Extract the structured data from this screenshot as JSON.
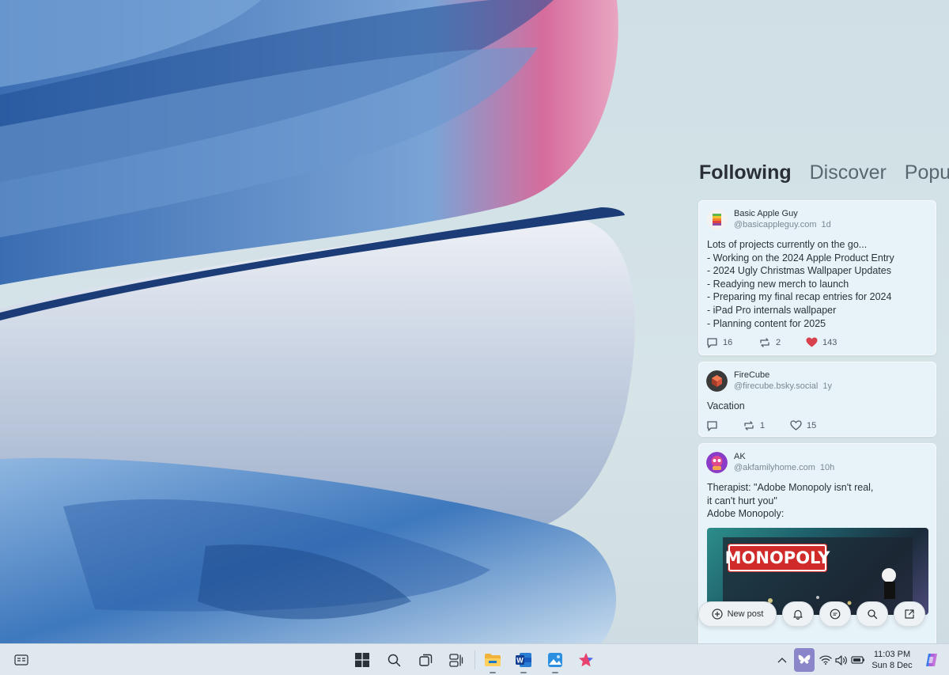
{
  "feed": {
    "tabs": [
      {
        "label": "Following"
      },
      {
        "label": "Discover"
      },
      {
        "label": "Popula"
      }
    ],
    "posts": [
      {
        "name": "Basic Apple Guy",
        "handle": "@basicappleguy.com",
        "time": "1d",
        "lines": [
          "Lots of projects currently on the go...",
          "- Working on the 2024 Apple Product Entry",
          "- 2024 Ugly Christmas Wallpaper Updates",
          "- Readying  new merch to launch",
          "- Preparing my final recap entries for 2024",
          "- iPad Pro internals wallpaper",
          "- Planning content for 2025"
        ],
        "replies": "16",
        "reposts": "2",
        "likes": "143"
      },
      {
        "name": "FireCube",
        "handle": "@firecube.bsky.social",
        "time": "1y",
        "lines": [
          "Vacation"
        ],
        "replies": "",
        "reposts": "1",
        "likes": "15"
      },
      {
        "name": "AK",
        "handle": "@akfamilyhome.com",
        "time": "10h",
        "lines": [
          "Therapist: \"Adobe Monopoly isn't real,",
          "it can't hurt you\"",
          "Adobe Monopoly:"
        ],
        "image_text": "MONOPOLY"
      }
    ],
    "new_post_label": "New post"
  },
  "taskbar": {
    "time": "11:03 PM",
    "date": "Sun 8 Dec"
  },
  "colors": {
    "like_active": "#d8414e",
    "accent": "#1185fe"
  }
}
